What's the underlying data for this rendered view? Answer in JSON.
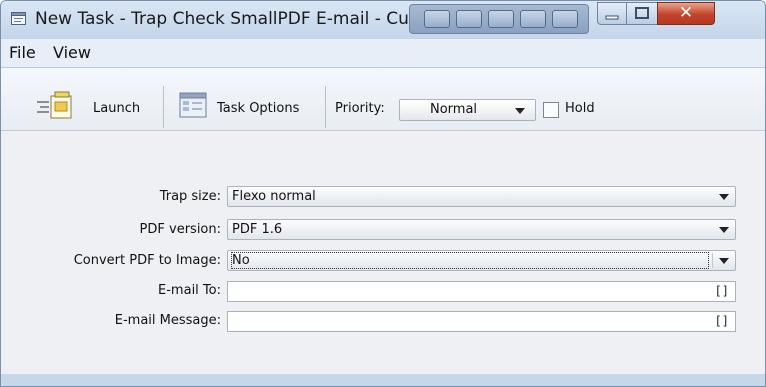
{
  "window": {
    "title": "New Task - Trap Check SmallPDF E-mail - Cus",
    "colors": {
      "frame": "#c7d7ea",
      "close": "#c4432a",
      "content": "#eef0f3"
    }
  },
  "menubar": {
    "items": [
      "File",
      "View"
    ]
  },
  "toolbar": {
    "launch_label": "Launch",
    "task_options_label": "Task Options",
    "priority_label": "Priority:",
    "priority_value": "Normal",
    "hold_label": "Hold",
    "hold_checked": false
  },
  "form": {
    "trap_size": {
      "label": "Trap size:",
      "value": "Flexo normal"
    },
    "pdf_version": {
      "label": "PDF version:",
      "value": "PDF 1.6"
    },
    "convert_pdf": {
      "label": "Convert PDF to Image:",
      "value": "No"
    },
    "email_to": {
      "label": "E-mail To:",
      "value": "",
      "icon": "[]"
    },
    "email_message": {
      "label": "E-mail Message:",
      "value": "",
      "icon": "[]"
    }
  },
  "icons": {
    "app": "task-window-icon",
    "launch": "launch-document-icon",
    "task_options": "task-options-icon",
    "dropdown": "chevron-down-icon",
    "field_expand": "expand-field-icon"
  }
}
